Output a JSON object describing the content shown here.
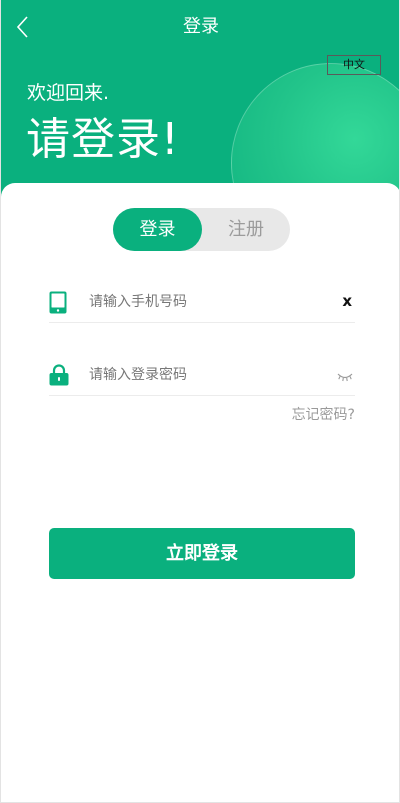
{
  "header": {
    "title": "登录",
    "back_icon": "chevron-left-icon",
    "language_label": "中文"
  },
  "hero": {
    "welcome": "欢迎回来.",
    "headline": "请登录!"
  },
  "tabs": [
    {
      "label": "登录",
      "active": true
    },
    {
      "label": "注册",
      "active": false
    }
  ],
  "form": {
    "phone": {
      "value": "",
      "placeholder": "请输入手机号码",
      "icon": "phone-icon",
      "clear_label": "x"
    },
    "password": {
      "value": "",
      "placeholder": "请输入登录密码",
      "icon": "lock-icon",
      "toggle_icon": "eye-closed-icon"
    },
    "forgot_label": "忘记密码?",
    "submit_label": "立即登录"
  },
  "colors": {
    "brand": "#0ab07e",
    "tab_inactive_bg": "#e8e8e8",
    "muted_text": "#9a9a9a"
  }
}
